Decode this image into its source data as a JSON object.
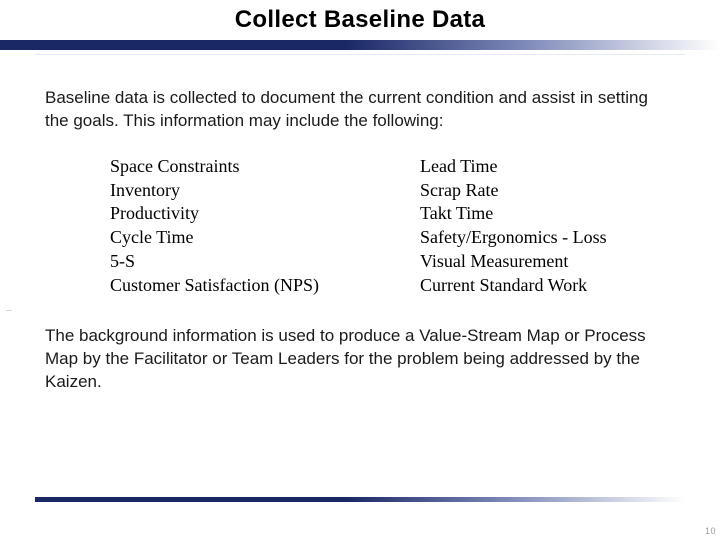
{
  "title": "Collect Baseline Data",
  "intro": "Baseline data is collected to document the current condition and assist in setting the goals. This information may include the following:",
  "columns": {
    "left": [
      "Space Constraints",
      "Inventory",
      "Productivity",
      "Cycle Time",
      "5-S",
      "Customer Satisfaction (NPS)"
    ],
    "right": [
      "Lead Time",
      "Scrap Rate",
      "Takt Time",
      "Safety/Ergonomics - Loss",
      "Visual Measurement",
      "Current Standard Work"
    ]
  },
  "outro": "The background information is used to produce a Value-Stream Map or Process Map by the Facilitator or Team Leaders for the problem being addressed by the Kaizen.",
  "page_number": "10"
}
